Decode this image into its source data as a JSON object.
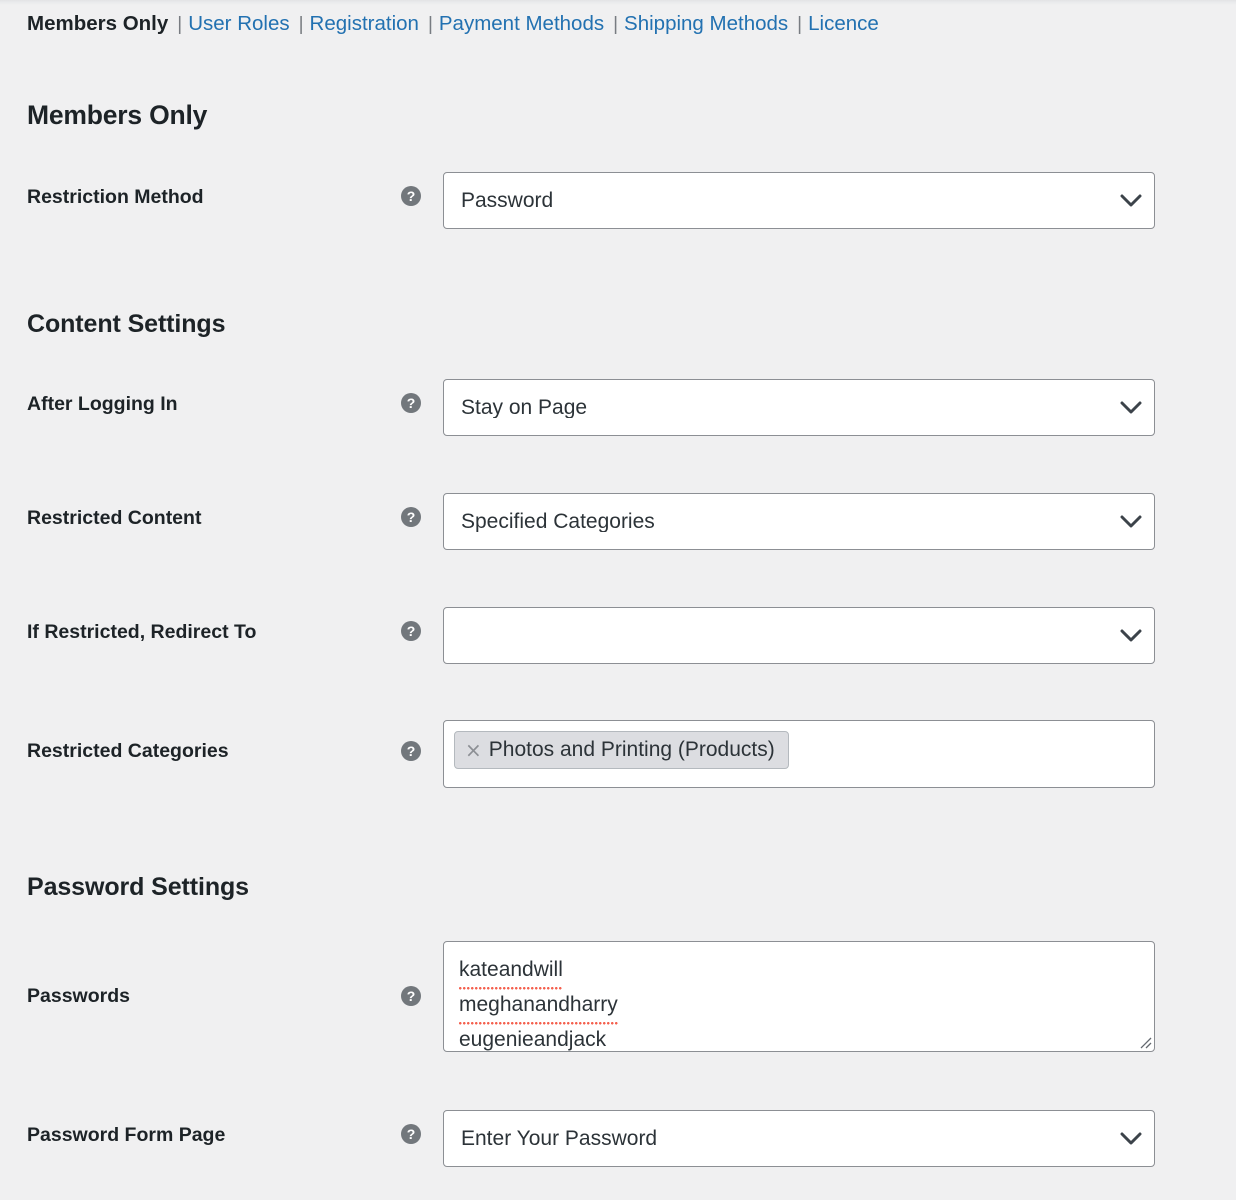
{
  "subnav": {
    "separator": "|",
    "items": [
      {
        "label": "Members Only",
        "current": true
      },
      {
        "label": "User Roles",
        "current": false
      },
      {
        "label": "Registration",
        "current": false
      },
      {
        "label": "Payment Methods",
        "current": false
      },
      {
        "label": "Shipping Methods",
        "current": false
      },
      {
        "label": "Licence",
        "current": false
      }
    ]
  },
  "page": {
    "title": "Members Only"
  },
  "help_icon": {
    "glyph": "?",
    "name": "help-icon",
    "color": "#72777c"
  },
  "colors": {
    "background": "#f0f0f1",
    "link": "#2271b1",
    "text": "#1d2327",
    "field_border": "#8c8f94",
    "chip_background": "#dcdde1",
    "spellcheck_underline": "#f4614f"
  },
  "sections": [
    {
      "id": "members-only",
      "heading": null,
      "fields": [
        {
          "id": "restriction-method",
          "label": "Restriction Method",
          "type": "select",
          "value": "Password",
          "placeholder": ""
        }
      ]
    },
    {
      "id": "content-settings",
      "heading": "Content Settings",
      "fields": [
        {
          "id": "after-logging-in",
          "label": "After Logging In",
          "type": "select",
          "value": "Stay on Page",
          "placeholder": ""
        },
        {
          "id": "restricted-content",
          "label": "Restricted Content",
          "type": "select",
          "value": "Specified Categories",
          "placeholder": ""
        },
        {
          "id": "if-restricted-redirect-to",
          "label": "If Restricted, Redirect To",
          "type": "select",
          "value": "",
          "placeholder": ""
        },
        {
          "id": "restricted-categories",
          "label": "Restricted Categories",
          "type": "multiselect",
          "chips": [
            {
              "label": "Photos and Printing (Products)",
              "remove": "×"
            }
          ]
        }
      ]
    },
    {
      "id": "password-settings",
      "heading": "Password Settings",
      "fields": [
        {
          "id": "passwords",
          "label": "Passwords",
          "type": "textarea",
          "lines": [
            "kateandwill",
            "meghanandharry",
            "eugenieandjack"
          ]
        },
        {
          "id": "password-form-page",
          "label": "Password Form Page",
          "type": "select",
          "value": "Enter Your Password",
          "placeholder": ""
        }
      ]
    }
  ]
}
